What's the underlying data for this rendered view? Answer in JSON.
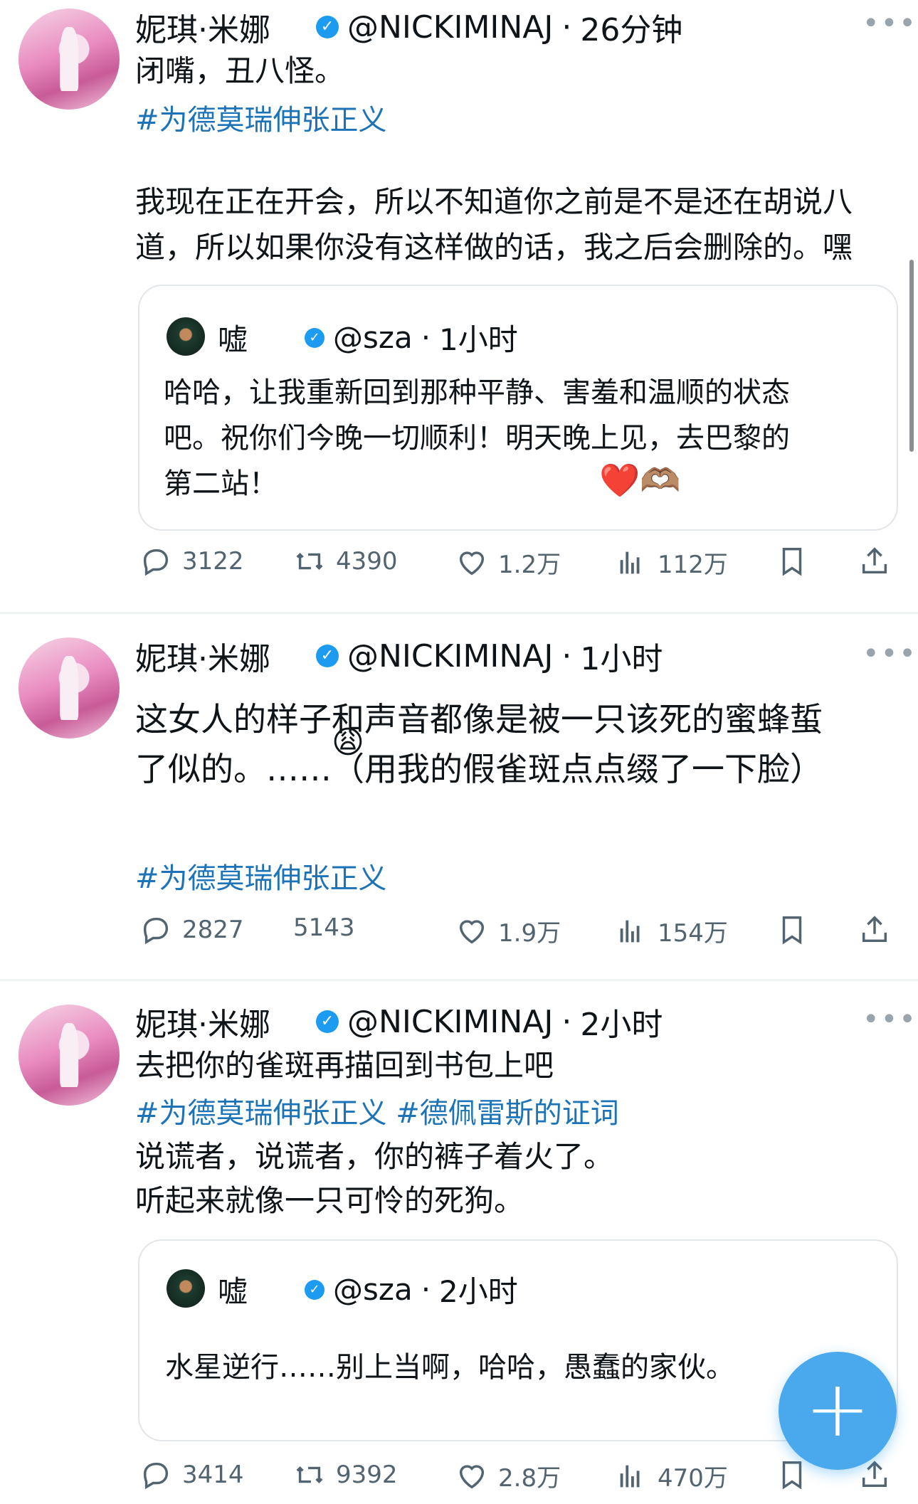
{
  "tweets": [
    {
      "name": "妮琪·米娜",
      "handle": "@NICKIMINAJ",
      "time": "26分钟",
      "line1": "闭嘴，丑八怪。",
      "hashtag1": "#为德莫瑞伸张正义",
      "para": [
        "我现在正在开会，所以不知道你之前是不是还在胡说八",
        "道，所以如果你没有这样做的话，我之后会删除的。嘿"
      ],
      "quote": {
        "name": "嘘",
        "handle": "@sza",
        "time": "1小时",
        "lines": [
          "哈哈，让我重新回到那种平静、害羞和温顺的状态",
          "吧。祝你们今晚一切顺利！明天晚上见，去巴黎的",
          "第二站！"
        ],
        "emoji": "❤️🫶🏽"
      },
      "stats": {
        "replies": "3122",
        "retweets": "4390",
        "likes": "1.2万",
        "views": "112万"
      }
    },
    {
      "name": "妮琪·米娜",
      "handle": "@NICKIMINAJ",
      "time": "1小时",
      "lines": [
        "这女人的样子和声音都像是被一只该死的蜜蜂蜇",
        "了似的。……（用我的假雀斑点点缀了一下脸）"
      ],
      "emoji": "😩",
      "hashtag": "#为德莫瑞伸张正义",
      "stats": {
        "replies": "2827",
        "retweets": "5143",
        "likes": "1.9万",
        "views": "154万"
      }
    },
    {
      "name": "妮琪·米娜",
      "handle": "@NICKIMINAJ",
      "time": "2小时",
      "line1": "去把你的雀斑再描回到书包上吧",
      "hashtags": "#为德莫瑞伸张正义 #德佩雷斯的证词",
      "lines": [
        "说谎者，说谎者，你的裤子着火了。",
        "听起来就像一只可怜的死狗。"
      ],
      "quote": {
        "name": "嘘",
        "handle": "@sza",
        "time": "2小时",
        "text": "水星逆行……别上当啊，哈哈，愚蠢的家伙。"
      },
      "stats": {
        "replies": "3414",
        "retweets": "9392",
        "likes": "2.8万",
        "views": "470万"
      }
    }
  ],
  "more_label": "•••",
  "fab_label": "+",
  "icons": [
    "reply-icon",
    "retweet-icon",
    "like-icon",
    "views-icon",
    "bookmark-icon",
    "share-icon",
    "verified-badge-icon"
  ],
  "colors": {
    "accent": "#1d9bf0",
    "hashtag": "#1d73b8",
    "muted": "#536471"
  }
}
